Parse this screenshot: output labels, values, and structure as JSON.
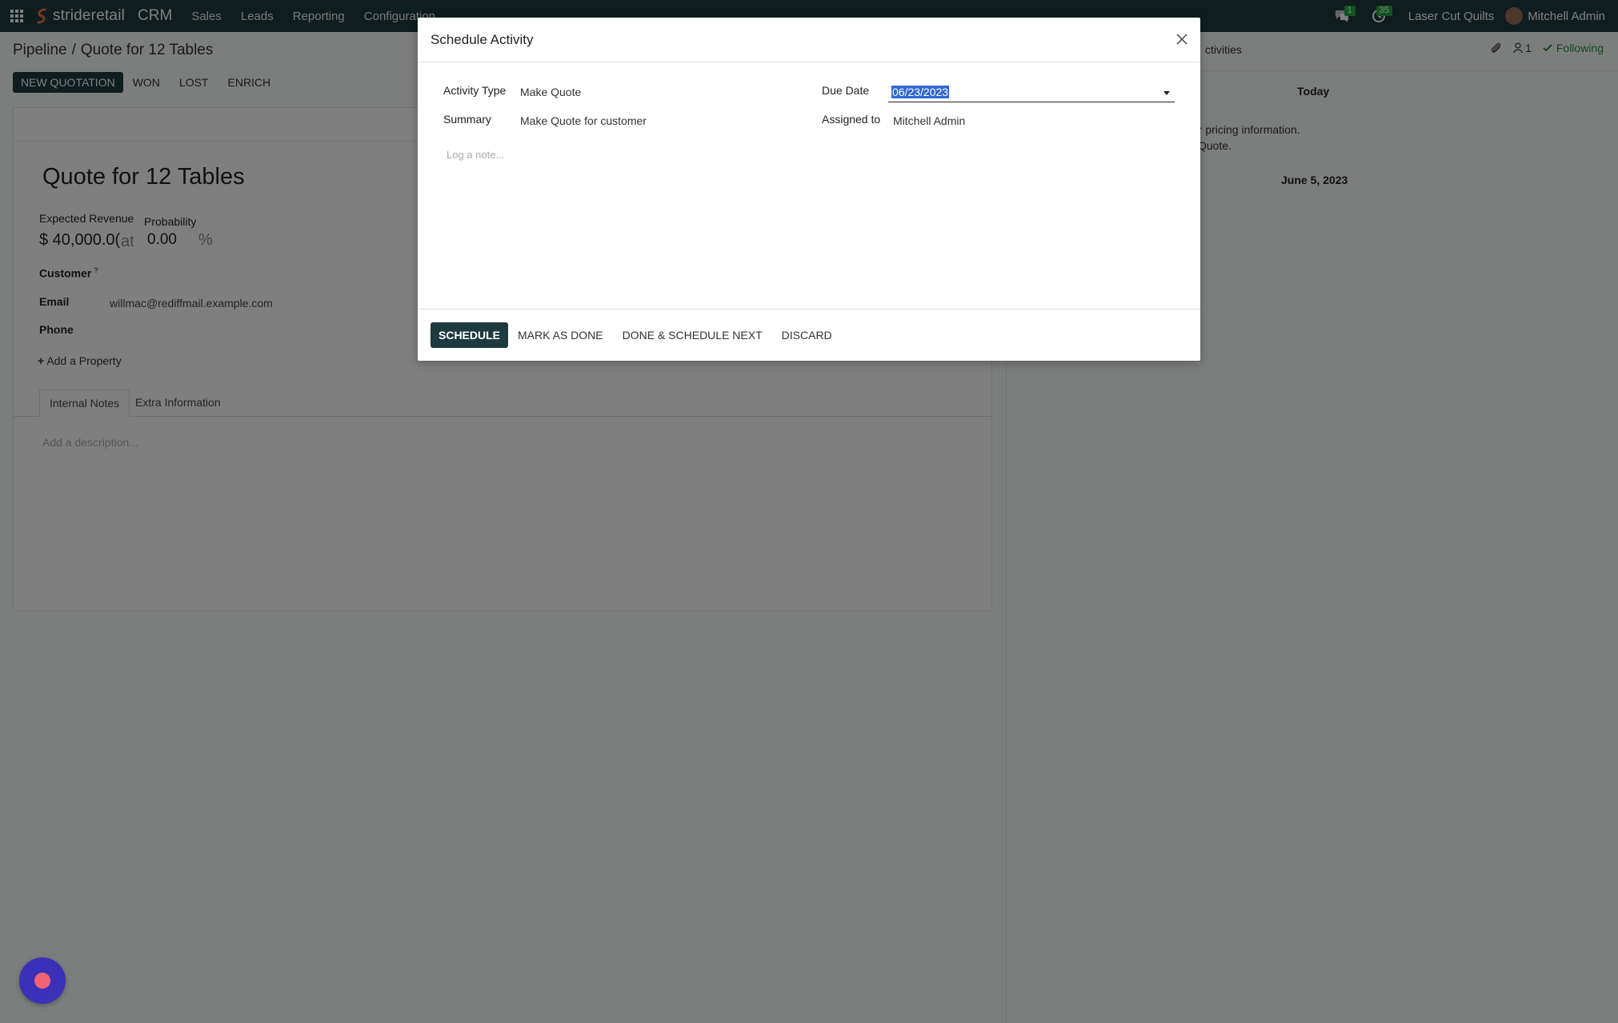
{
  "navbar": {
    "brand_name": "strideretail",
    "app_name": "CRM",
    "menu": [
      "Sales",
      "Leads",
      "Reporting",
      "Configuration"
    ],
    "messages_badge": "1",
    "activities_badge": "35",
    "company": "Laser Cut Quilts",
    "user": "Mitchell Admin"
  },
  "breadcrumb": {
    "parent": "Pipeline",
    "sep": "/",
    "current": "Quote for 12 Tables"
  },
  "status_buttons": {
    "new_quotation": "NEW QUOTATION",
    "won": "WON",
    "lost": "LOST",
    "enrich": "ENRICH"
  },
  "chatter_toolbar": {
    "activities": "ctivities",
    "followers_count": "1",
    "following": "Following"
  },
  "form": {
    "title": "Quote for 12 Tables",
    "expected_revenue_label": "Expected Revenue",
    "expected_revenue_value": "$ 40,000.0(",
    "at_label": "at",
    "probability_label": "Probability",
    "probability_value": "0.00",
    "percent": "%",
    "customer_label": "Customer",
    "customer_help": "?",
    "email_label": "Email",
    "email_value": "willmac@rediffmail.example.com",
    "phone_label": "Phone",
    "add_property": "Add a Property",
    "tabs": [
      "Internal Notes",
      "Extra Information"
    ],
    "description_placeholder": "Add a description..."
  },
  "chatter": {
    "today_label": "Today",
    "message_line1": "er pricing information.",
    "message_line2": "Quote.",
    "date_label": "June 5, 2023"
  },
  "modal": {
    "title": "Schedule Activity",
    "activity_type_label": "Activity Type",
    "activity_type_value": "Make Quote",
    "summary_label": "Summary",
    "summary_value": "Make Quote for customer",
    "due_date_label": "Due Date",
    "due_date_value": "06/23/2023",
    "assigned_to_label": "Assigned to",
    "assigned_to_value": "Mitchell Admin",
    "note_placeholder": "Log a note...",
    "buttons": {
      "schedule": "SCHEDULE",
      "mark_done": "MARK AS DONE",
      "done_next": "DONE & SCHEDULE NEXT",
      "discard": "DISCARD"
    }
  },
  "colors": {
    "primary": "#1f3a3f",
    "badge": "#28a745",
    "following": "#2b8a3e",
    "selection": "#3367d6",
    "record_button": "#3a31b8"
  }
}
